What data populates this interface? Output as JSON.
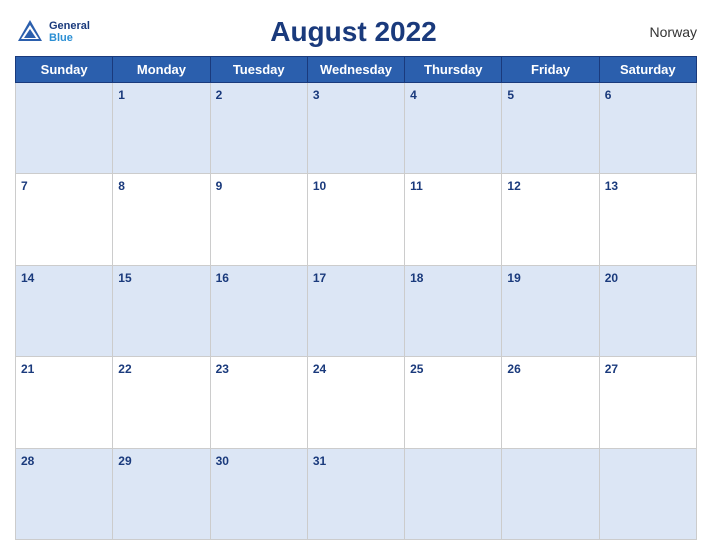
{
  "header": {
    "logo_line1": "General",
    "logo_line2": "Blue",
    "title": "August 2022",
    "country": "Norway"
  },
  "days_of_week": [
    "Sunday",
    "Monday",
    "Tuesday",
    "Wednesday",
    "Thursday",
    "Friday",
    "Saturday"
  ],
  "weeks": [
    [
      {
        "day": "",
        "shade": true
      },
      {
        "day": "1",
        "shade": true
      },
      {
        "day": "2",
        "shade": true
      },
      {
        "day": "3",
        "shade": true
      },
      {
        "day": "4",
        "shade": true
      },
      {
        "day": "5",
        "shade": true
      },
      {
        "day": "6",
        "shade": true
      }
    ],
    [
      {
        "day": "7",
        "shade": false
      },
      {
        "day": "8",
        "shade": false
      },
      {
        "day": "9",
        "shade": false
      },
      {
        "day": "10",
        "shade": false
      },
      {
        "day": "11",
        "shade": false
      },
      {
        "day": "12",
        "shade": false
      },
      {
        "day": "13",
        "shade": false
      }
    ],
    [
      {
        "day": "14",
        "shade": true
      },
      {
        "day": "15",
        "shade": true
      },
      {
        "day": "16",
        "shade": true
      },
      {
        "day": "17",
        "shade": true
      },
      {
        "day": "18",
        "shade": true
      },
      {
        "day": "19",
        "shade": true
      },
      {
        "day": "20",
        "shade": true
      }
    ],
    [
      {
        "day": "21",
        "shade": false
      },
      {
        "day": "22",
        "shade": false
      },
      {
        "day": "23",
        "shade": false
      },
      {
        "day": "24",
        "shade": false
      },
      {
        "day": "25",
        "shade": false
      },
      {
        "day": "26",
        "shade": false
      },
      {
        "day": "27",
        "shade": false
      }
    ],
    [
      {
        "day": "28",
        "shade": true
      },
      {
        "day": "29",
        "shade": true
      },
      {
        "day": "30",
        "shade": true
      },
      {
        "day": "31",
        "shade": true
      },
      {
        "day": "",
        "shade": true
      },
      {
        "day": "",
        "shade": true
      },
      {
        "day": "",
        "shade": true
      }
    ]
  ]
}
